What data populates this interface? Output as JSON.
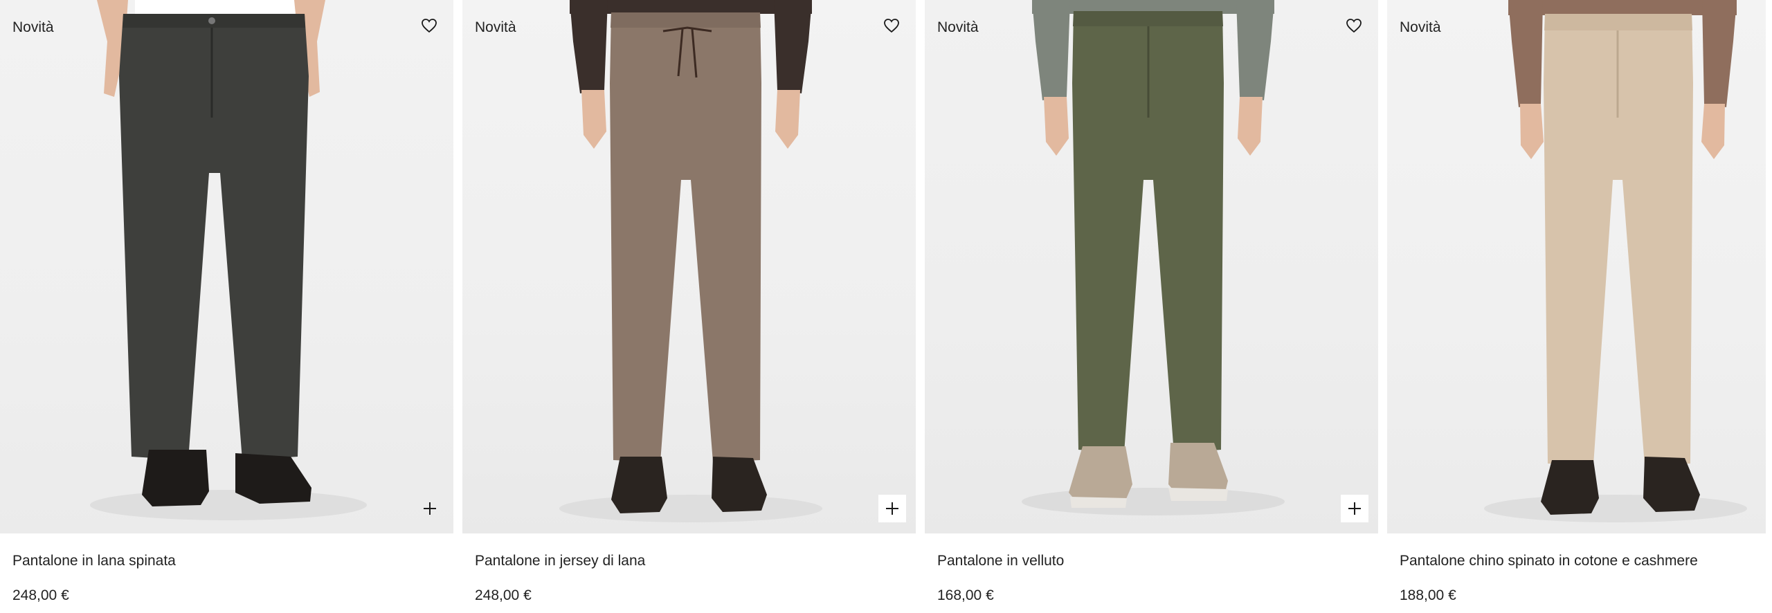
{
  "products": [
    {
      "badge": "Novità",
      "name": "Pantalone in lana spinata",
      "price": "248,00 €",
      "wishlist_icon": "heart-icon",
      "add_icon": "plus-icon",
      "colors": {
        "trouser": "#3e3f3c",
        "top": "#ffffff",
        "shoe": "#1e1b19"
      }
    },
    {
      "badge": "Novità",
      "name": "Pantalone in jersey di lana",
      "price": "248,00 €",
      "wishlist_icon": "heart-icon",
      "add_icon": "plus-icon",
      "colors": {
        "trouser": "#8b7769",
        "top": "#3a2f2b",
        "shoe": "#2a2420"
      }
    },
    {
      "badge": "Novità",
      "name": "Pantalone in velluto",
      "price": "168,00 €",
      "wishlist_icon": "heart-icon",
      "add_icon": "plus-icon",
      "colors": {
        "trouser": "#5e6549",
        "top": "#7e857c",
        "shoe": "#b9a996"
      }
    },
    {
      "badge": "Novità",
      "name": "Pantalone chino spinato in cotone e cashmere",
      "price": "188,00 €",
      "wishlist_icon": "heart-icon",
      "add_icon": "plus-icon",
      "colors": {
        "trouser": "#d7c3ab",
        "top": "#8f6e5d",
        "shoe": "#2a2420"
      }
    }
  ]
}
